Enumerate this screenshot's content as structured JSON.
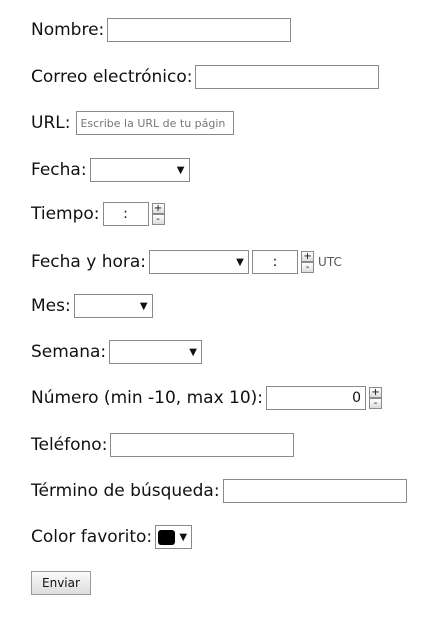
{
  "form": {
    "nombre": {
      "label": "Nombre:",
      "value": ""
    },
    "correo": {
      "label": "Correo electrónico:",
      "value": ""
    },
    "url": {
      "label": "URL:",
      "placeholder": "Escribe la URL de tu págin"
    },
    "fecha": {
      "label": "Fecha:",
      "value": ""
    },
    "tiempo": {
      "label": "Tiempo:",
      "value": ":"
    },
    "fecha_hora": {
      "label": "Fecha y hora:",
      "time_value": ":",
      "tz": "UTC"
    },
    "mes": {
      "label": "Mes:",
      "value": ""
    },
    "semana": {
      "label": "Semana:",
      "value": ""
    },
    "numero": {
      "label": "Número (min -10, max 10):",
      "value": "0"
    },
    "telefono": {
      "label": "Teléfono:",
      "value": ""
    },
    "busqueda": {
      "label": "Término de búsqueda:",
      "value": ""
    },
    "color": {
      "label": "Color favorito:",
      "value": "#000000"
    },
    "submit_label": "Enviar"
  },
  "icons": {
    "dropdown": "▼",
    "spin_up": "+",
    "spin_down": "-"
  }
}
